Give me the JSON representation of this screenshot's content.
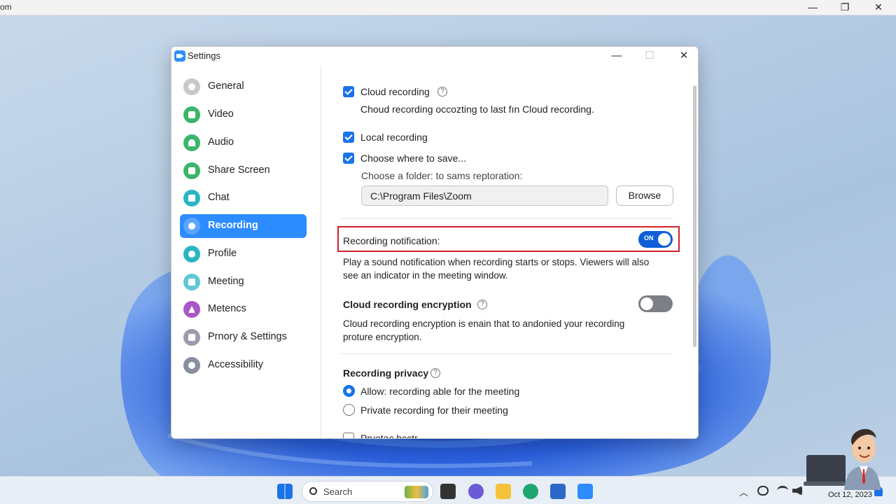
{
  "outer_window": {
    "title": "om",
    "minimize": "—",
    "maximize": "❐",
    "close": "✕"
  },
  "window": {
    "title": "Settings",
    "minimize": "—",
    "maximize": "☐",
    "close": "✕"
  },
  "sidebar": {
    "items": [
      {
        "label": "General",
        "icon": "gear-icon",
        "color": "#c8c8c8"
      },
      {
        "label": "Video",
        "icon": "video-icon",
        "color": "#3bb56a"
      },
      {
        "label": "Audio",
        "icon": "headphones-icon",
        "color": "#3bb56a"
      },
      {
        "label": "Share Screen",
        "icon": "share-screen-icon",
        "color": "#3bb56a"
      },
      {
        "label": "Chat",
        "icon": "chat-icon",
        "color": "#2ab5c4"
      },
      {
        "label": "Recording",
        "icon": "record-icon",
        "color": "#2d8cff",
        "active": true
      },
      {
        "label": "Profile",
        "icon": "profile-icon",
        "color": "#2ab5c4"
      },
      {
        "label": "Meeting",
        "icon": "meeting-icon",
        "color": "#5fc8d8"
      },
      {
        "label": "Metencs",
        "icon": "metrics-icon",
        "color": "#a857c8"
      },
      {
        "label": "Prnory & Settings",
        "icon": "privacy-icon",
        "color": "#9b9bb0"
      },
      {
        "label": "Accessibility",
        "icon": "accessibility-icon",
        "color": "#8a8fa0"
      }
    ]
  },
  "recording": {
    "cloud_recording": {
      "label": "Cloud recording",
      "checked": true,
      "help": "?",
      "desc": "Choud recording occozting to last fın Cloud recording."
    },
    "local_recording": {
      "label": "Local recording",
      "checked": true
    },
    "choose_save": {
      "label": "Choose where to save...",
      "checked": true,
      "desc": "Choose a folder: to sams reptoration:"
    },
    "folder_path": "C:\\Program Files\\Zoom",
    "browse_label": "Browse",
    "notification": {
      "label": "Recording notification:",
      "state": "ON",
      "desc_line1": "Play a sound notification when recording starts or stops. Viewers will also",
      "desc_line2": "see an indicator in the meeting window."
    },
    "encryption": {
      "label": "Cloud recording encryption",
      "help": "?",
      "enabled": false,
      "desc_line1": "Cloud recording encryption is enain that to andonied your recording",
      "desc_line2": "proture encryption."
    },
    "privacy": {
      "label": "Recording privacy",
      "help": "?",
      "options": [
        "Allow: recording able for the meeting",
        "Private recording for their meeting"
      ],
      "selected": 0
    },
    "cutoff_item": "Prvatac hcctr"
  },
  "taskbar": {
    "search_placeholder": "Search",
    "date": "Oct 12, 2023",
    "accent": "#1a73e8"
  }
}
